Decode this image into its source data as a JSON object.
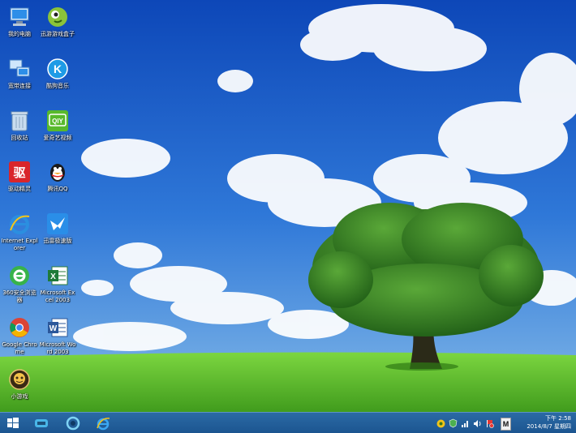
{
  "desktop": {
    "icons": [
      {
        "label": "我的电脑",
        "icon": "computer-icon"
      },
      {
        "label": "迅游游戏盒子",
        "icon": "game-icon"
      },
      {
        "label": "宽带连接",
        "icon": "broadband-icon"
      },
      {
        "label": "酷狗音乐",
        "icon": "kugou-icon"
      },
      {
        "label": "回收站",
        "icon": "recycle-bin-icon"
      },
      {
        "label": "爱奇艺视频",
        "icon": "iqiyi-icon"
      },
      {
        "label": "驱动精灵",
        "icon": "driver-icon"
      },
      {
        "label": "腾讯QQ",
        "icon": "qq-icon"
      },
      {
        "label": "Internet Explorer",
        "icon": "ie-icon"
      },
      {
        "label": "迅雷极速版",
        "icon": "thunder-icon"
      },
      {
        "label": "360安全浏览器",
        "icon": "browser-360-icon"
      },
      {
        "label": "Microsoft Excel 2003",
        "icon": "excel-icon"
      },
      {
        "label": "Google Chrome",
        "icon": "chrome-icon"
      },
      {
        "label": "Microsoft Word 2003",
        "icon": "word-icon"
      },
      {
        "label": "小游戏",
        "icon": "mini-game-icon"
      }
    ]
  },
  "taskbar": {
    "pinned": [
      "start-icon",
      "teamviewer-icon",
      "media-icon",
      "ie-icon"
    ],
    "tray": [
      "shield-icon",
      "security-icon",
      "network-icon",
      "volume-icon",
      "flag-icon",
      "input-method-icon"
    ],
    "input_method": "M",
    "time": "下午 2:58",
    "date": "2014/8/7 星期四"
  },
  "colors": {
    "sky": "#1a5ec8",
    "grass": "#5cbf2a",
    "taskbar": "#1f5a94"
  }
}
